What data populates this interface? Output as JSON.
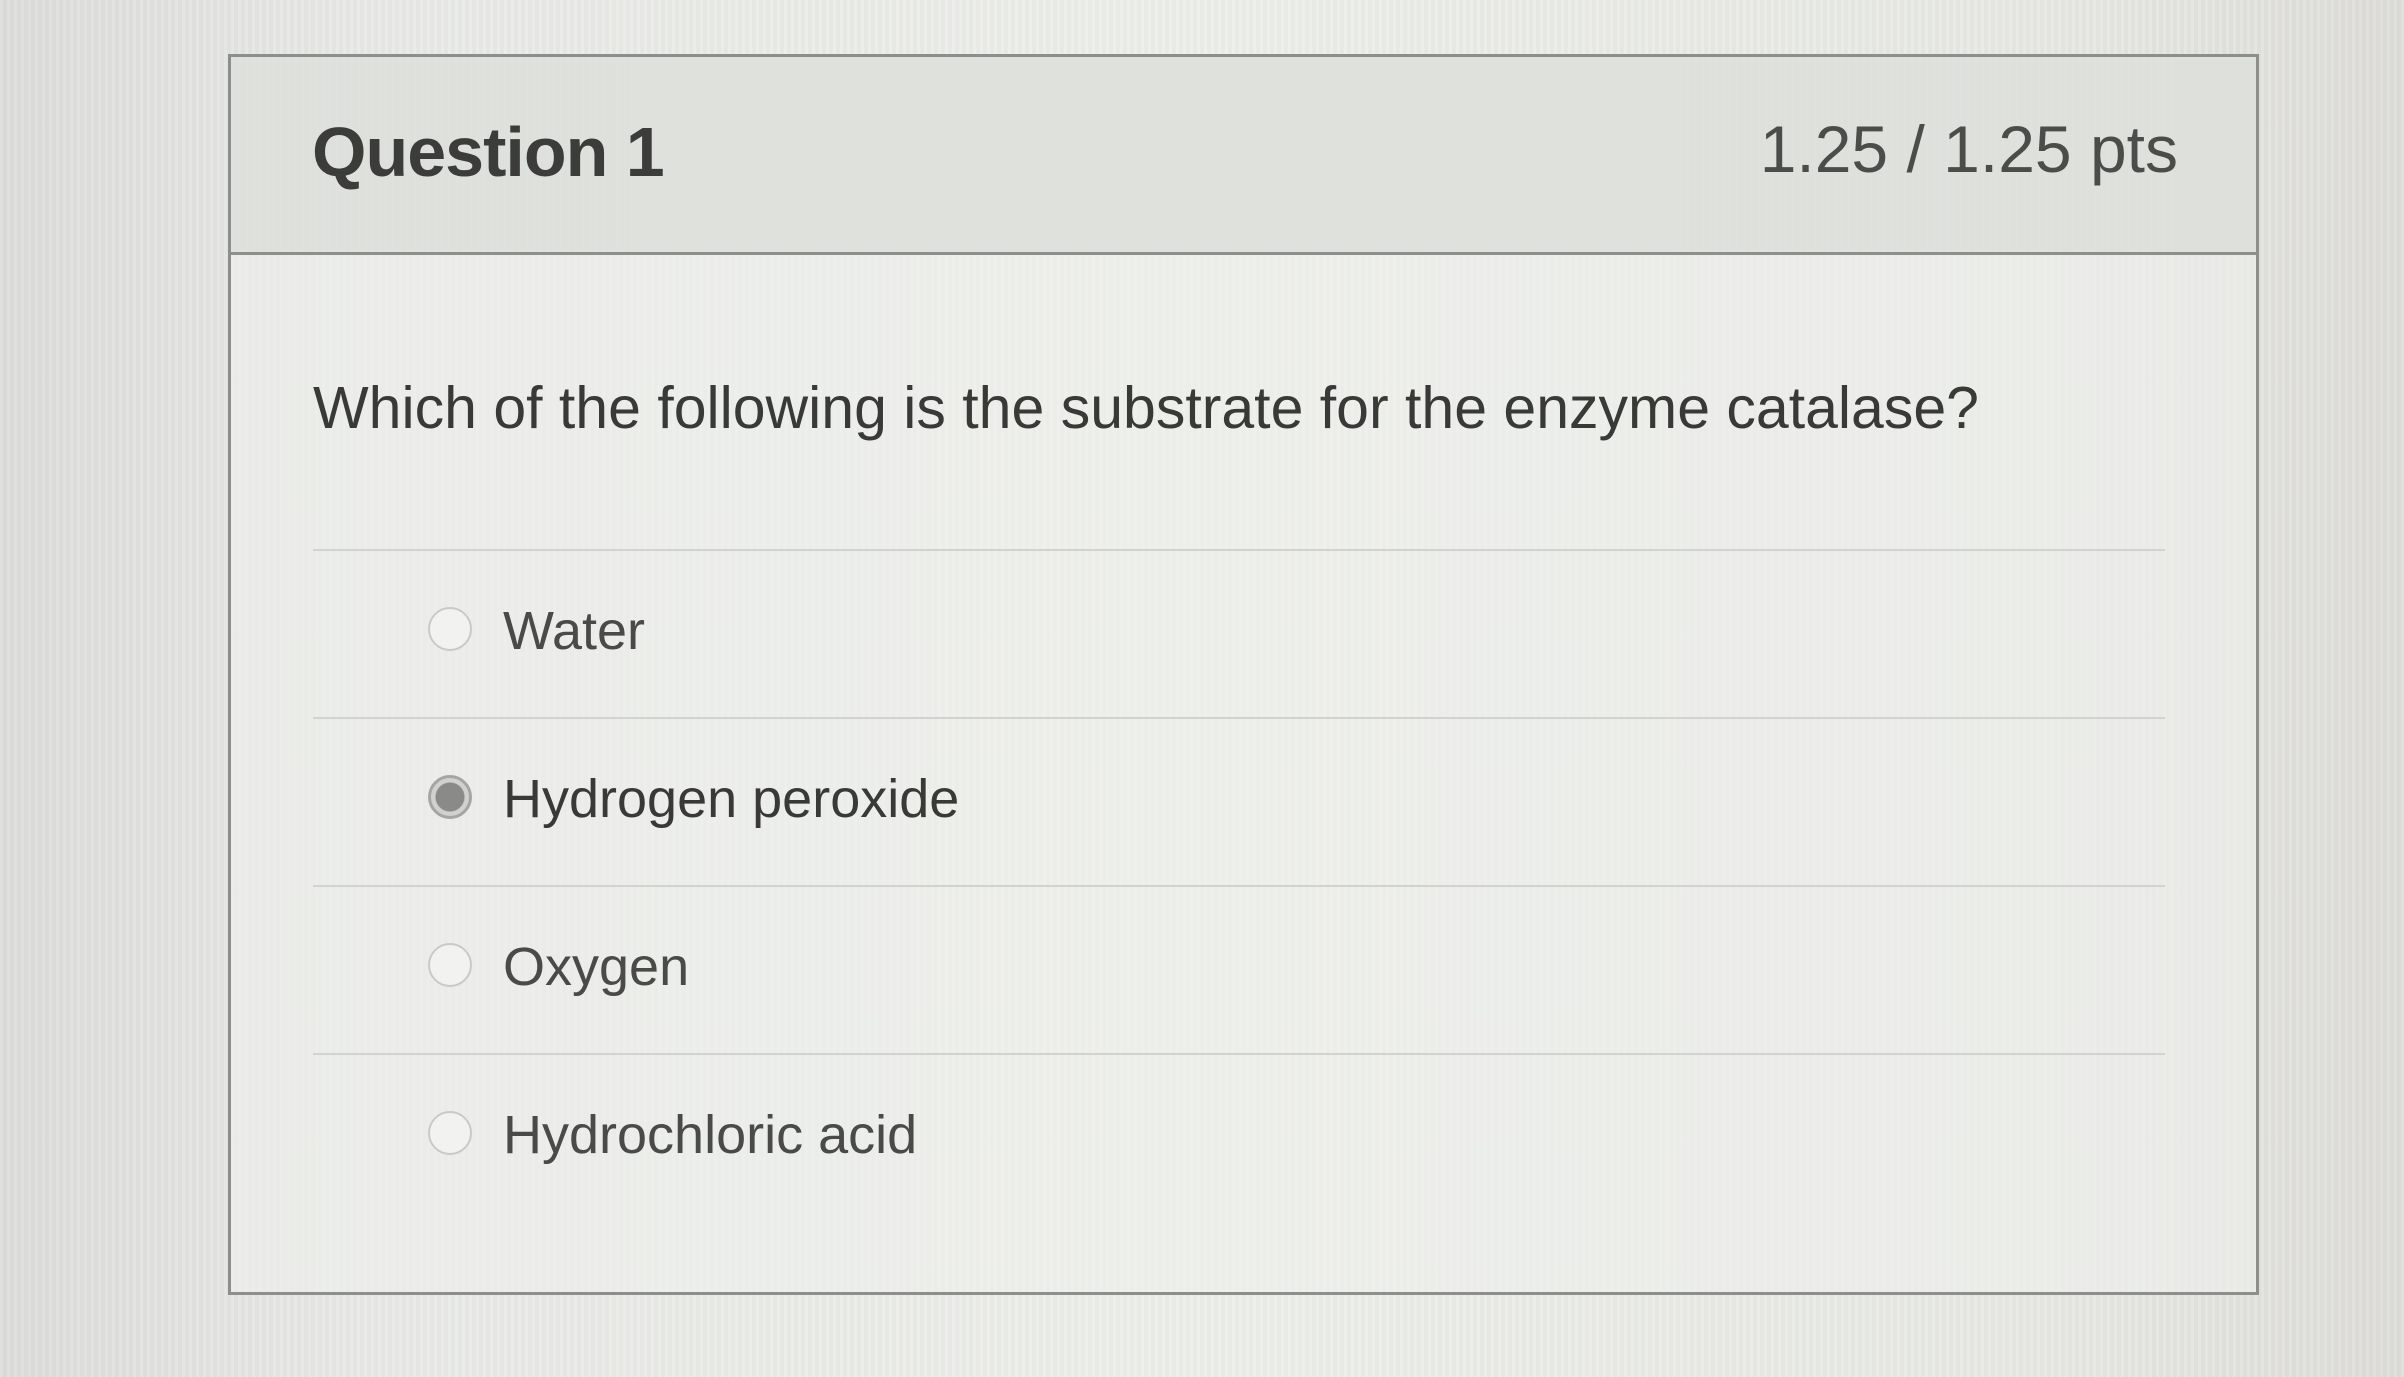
{
  "question": {
    "title": "Question 1",
    "points": "1.25 / 1.25 pts",
    "prompt": "Which of the following is the substrate for the enzyme catalase?"
  },
  "answers": [
    {
      "label": "Water",
      "selected": false
    },
    {
      "label": "Hydrogen peroxide",
      "selected": true
    },
    {
      "label": "Oxygen",
      "selected": false
    },
    {
      "label": "Hydrochloric acid",
      "selected": false
    }
  ],
  "icons": {
    "unselected_option": "radio-icon",
    "selected_option": "radio-selected-icon"
  },
  "colors": {
    "border": "#8d8f8c",
    "header_background": "#dadcd8",
    "text": "#393a38"
  }
}
